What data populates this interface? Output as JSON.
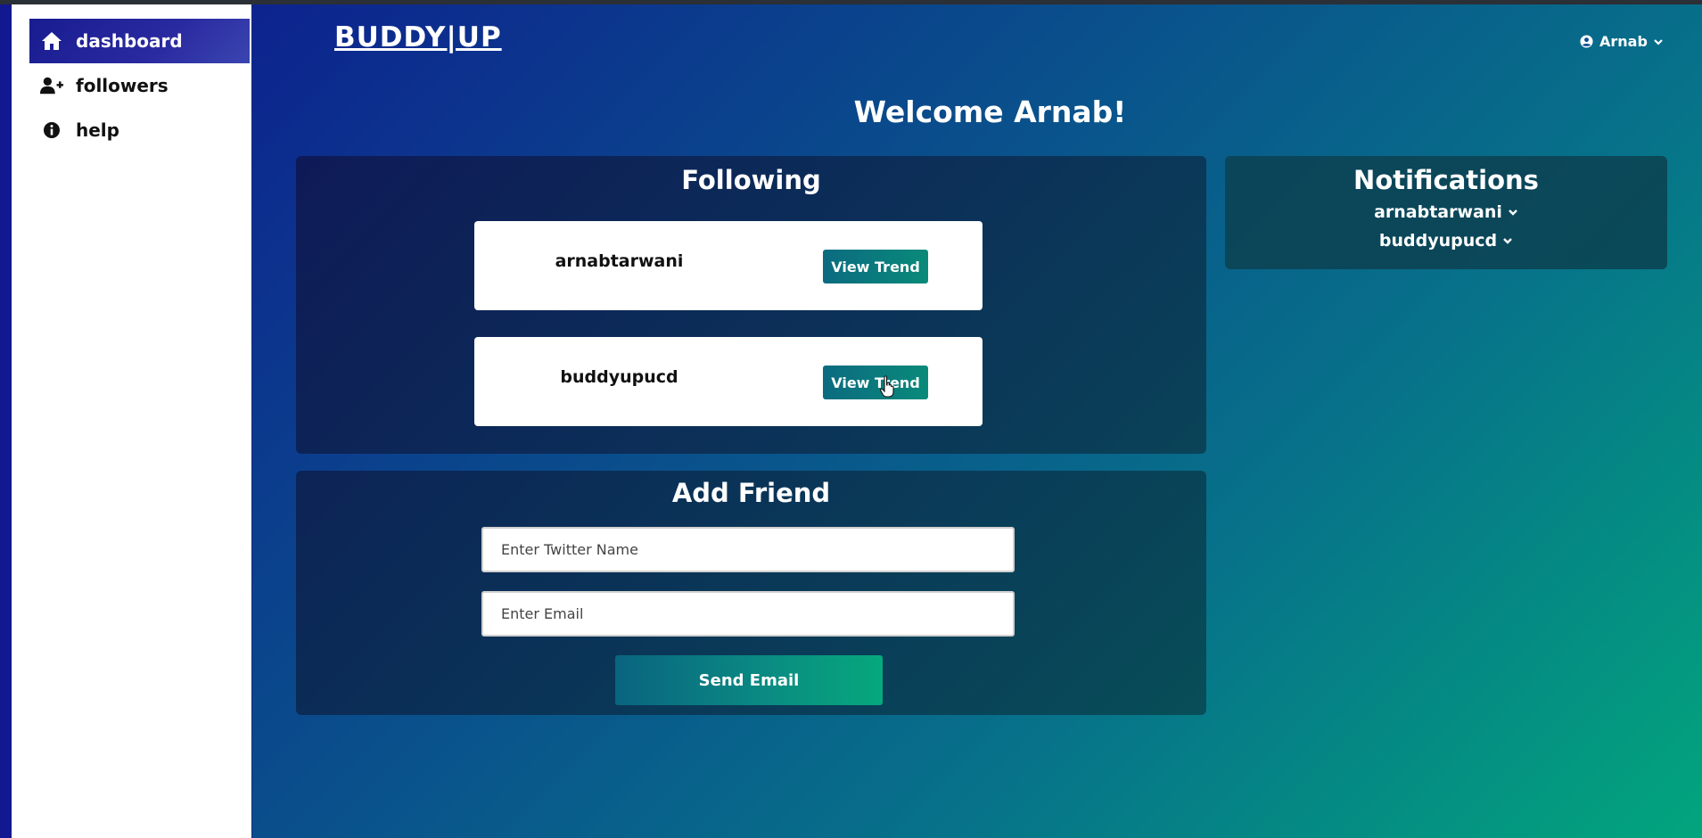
{
  "sidebar": {
    "items": [
      {
        "label": "dashboard",
        "icon": "home-icon",
        "active": true
      },
      {
        "label": "followers",
        "icon": "user-plus-icon",
        "active": false
      },
      {
        "label": "help",
        "icon": "info-circle-icon",
        "active": false
      }
    ]
  },
  "header": {
    "brand": "BUDDY|UP",
    "user": "Arnab"
  },
  "main": {
    "welcome": "Welcome Arnab!",
    "following": {
      "title": "Following",
      "items": [
        {
          "name": "arnabtarwani",
          "button": "View Trend"
        },
        {
          "name": "buddyupucd",
          "button": "View Trend"
        }
      ]
    },
    "add_friend": {
      "title": "Add Friend",
      "twitter_placeholder": "Enter Twitter Name",
      "email_placeholder": "Enter Email",
      "send_label": "Send Email"
    },
    "notifications": {
      "title": "Notifications",
      "items": [
        "arnabtarwani",
        "buddyupucd"
      ]
    }
  },
  "colors": {
    "accent_teal": "#0a8a7a",
    "brand_blue": "#181c8f",
    "gradient_end": "#02a57d"
  }
}
